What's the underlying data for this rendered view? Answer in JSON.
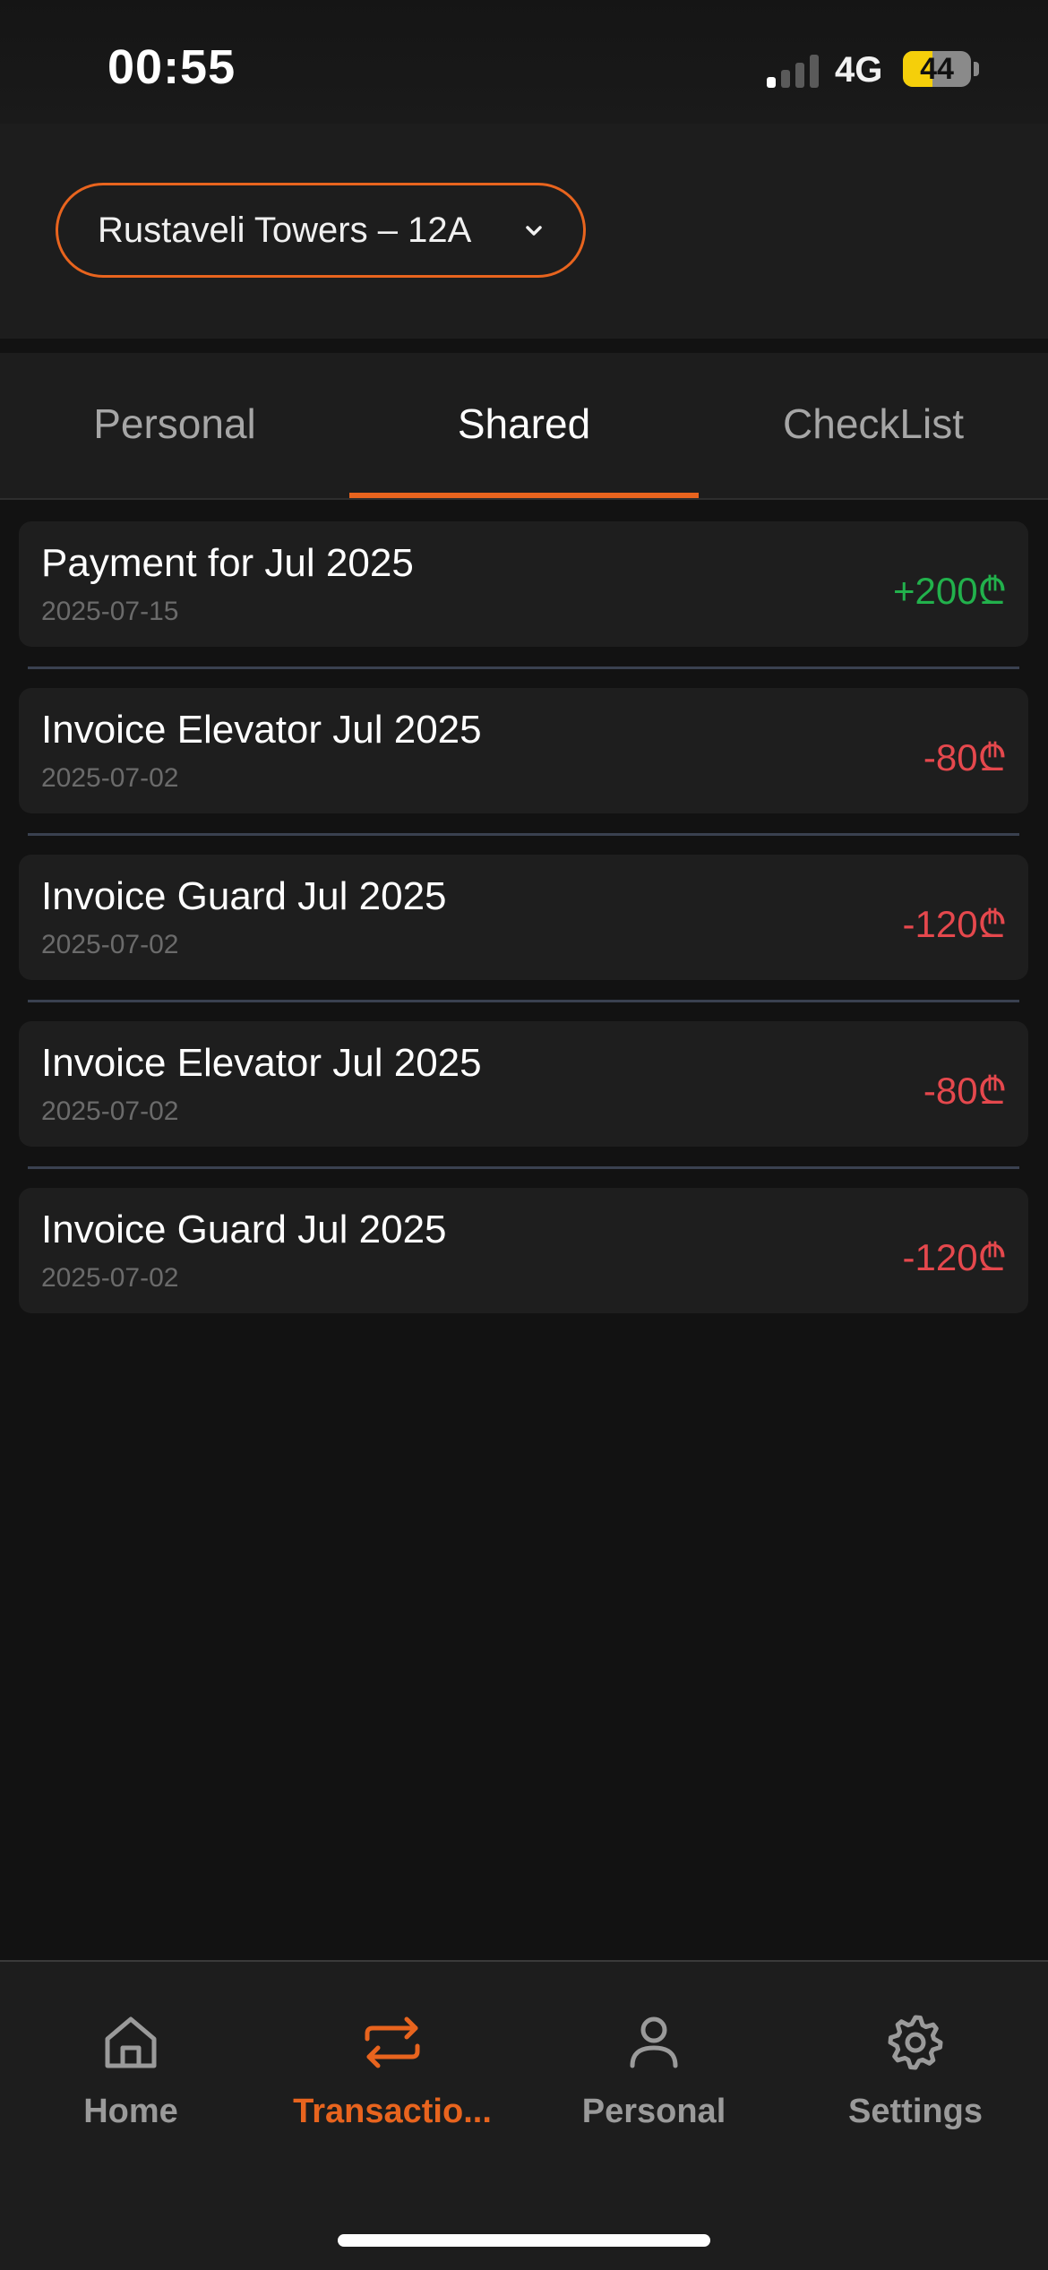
{
  "status_bar": {
    "time": "00:55",
    "network": "4G",
    "battery_level": "44",
    "battery_fraction": 0.44
  },
  "header": {
    "property_name": "Rustaveli Towers – 12A",
    "chevron_icon": "chevron-down-icon",
    "accent_color": "#e8641e"
  },
  "tabs": [
    {
      "label": "Personal",
      "active": false
    },
    {
      "label": "Shared",
      "active": true
    },
    {
      "label": "CheckList",
      "active": false
    }
  ],
  "transactions": [
    {
      "title": "Payment for Jul 2025",
      "date": "2025-07-15",
      "amount": "+200₾",
      "color": "#22b14c"
    },
    {
      "title": "Invoice Elevator Jul 2025",
      "date": "2025-07-02",
      "amount": "-80₾",
      "color": "#e5484d"
    },
    {
      "title": "Invoice Guard Jul 2025",
      "date": "2025-07-02",
      "amount": "-120₾",
      "color": "#e5484d"
    },
    {
      "title": "Invoice Elevator Jul 2025",
      "date": "2025-07-02",
      "amount": "-80₾",
      "color": "#e5484d"
    },
    {
      "title": "Invoice Guard Jul 2025",
      "date": "2025-07-02",
      "amount": "-120₾",
      "color": "#e5484d"
    }
  ],
  "bottom_nav": [
    {
      "label": "Home",
      "icon": "home-icon",
      "active": false
    },
    {
      "label": "Transactio...",
      "icon": "transfer-arrows-icon",
      "active": true
    },
    {
      "label": "Personal",
      "icon": "person-icon",
      "active": false
    },
    {
      "label": "Settings",
      "icon": "gear-icon",
      "active": false
    }
  ]
}
